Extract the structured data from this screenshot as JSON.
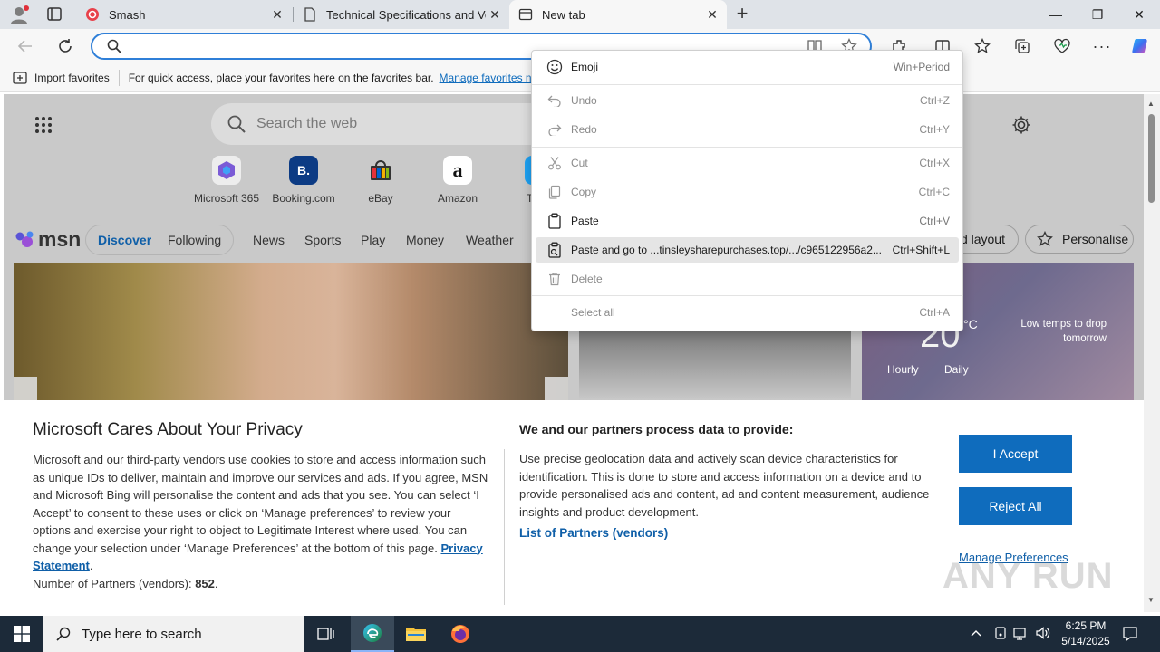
{
  "tabs": [
    {
      "title": "Smash",
      "close": "✕"
    },
    {
      "title": "Technical Specifications and Ven",
      "close": "✕"
    },
    {
      "title": "New tab",
      "close": "✕"
    }
  ],
  "new_tab_glyph": "+",
  "window_controls": {
    "minimize": "—",
    "restore": "❐",
    "close": "✕"
  },
  "address": {
    "value": "",
    "placeholder": ""
  },
  "favorites_bar": {
    "import_label": "Import favorites",
    "hint": "For quick access, place your favorites here on the favorites bar.",
    "manage_link": "Manage favorites nov"
  },
  "newtab": {
    "search_placeholder": "Search the web",
    "shortcuts": [
      {
        "label": "Microsoft 365",
        "glyph": "",
        "color": "#7b5bd6"
      },
      {
        "label": "Booking.com",
        "glyph": "B.",
        "color": "#0c3b84"
      },
      {
        "label": "eBay",
        "glyph": "",
        "color": "#e53238"
      },
      {
        "label": "Amazon",
        "glyph": "a",
        "color": "#ffffff"
      },
      {
        "label": "T",
        "glyph": "",
        "color": "#1da1f2"
      }
    ],
    "msn": {
      "logo": "msn",
      "nav": [
        "Discover",
        "Following",
        "News",
        "Sports",
        "Play",
        "Money",
        "Weather"
      ],
      "layout_btn": "d layout",
      "personalise_btn": "Personalise"
    },
    "weather": {
      "temp": "20",
      "unit": "°C",
      "note": "Low temps to drop tomorrow",
      "tabs": [
        "Hourly",
        "Daily"
      ]
    }
  },
  "privacy": {
    "title": "Microsoft Cares About Your Privacy",
    "body": "Microsoft and our third-party vendors use cookies to store and access information such as unique IDs to deliver, maintain and improve our services and ads. If you agree, MSN and Microsoft Bing will personalise the content and ads that you see. You can select ‘I Accept’ to consent to these uses or click on ‘Manage preferences’ to review your options and exercise your right to object to Legitimate Interest where used.  You can change your selection under ‘Manage Preferences’ at the bottom of this page.",
    "privacy_link": "Privacy Statement",
    "partners_label": "Number of Partners (vendors):",
    "partners_count": "852",
    "right_title": "We and our partners process data to provide:",
    "right_body": "Use precise geolocation data and actively scan device characteristics for identification. This is done to store and access information on a device and to provide personalised ads and content, ad and content measurement, audience insights and product development.",
    "list_partners": "List of Partners (vendors)",
    "accept": "I Accept",
    "reject": "Reject All",
    "manage": "Manage Preferences",
    "watermark": "ANY RUN"
  },
  "context_menu": [
    {
      "label": "Emoji",
      "shortcut": "Win+Period",
      "icon": "emoji-icon",
      "enabled": true
    },
    {
      "label": "Undo",
      "shortcut": "Ctrl+Z",
      "icon": "undo-icon",
      "enabled": false
    },
    {
      "label": "Redo",
      "shortcut": "Ctrl+Y",
      "icon": "redo-icon",
      "enabled": false
    },
    {
      "label": "Cut",
      "shortcut": "Ctrl+X",
      "icon": "cut-icon",
      "enabled": false
    },
    {
      "label": "Copy",
      "shortcut": "Ctrl+C",
      "icon": "copy-icon",
      "enabled": false
    },
    {
      "label": "Paste",
      "shortcut": "Ctrl+V",
      "icon": "paste-icon",
      "enabled": true
    },
    {
      "label": "Paste and go to ...tinsleysharepurchases.top/.../c965122956a2...",
      "shortcut": "Ctrl+Shift+L",
      "icon": "paste-go-icon",
      "enabled": true,
      "highlighted": true
    },
    {
      "label": "Delete",
      "shortcut": "",
      "icon": "delete-icon",
      "enabled": false
    },
    {
      "label": "Select all",
      "shortcut": "Ctrl+A",
      "icon": "",
      "enabled": false
    }
  ],
  "taskbar": {
    "search_placeholder": "Type here to search",
    "time": "6:25 PM",
    "date": "5/14/2025"
  }
}
